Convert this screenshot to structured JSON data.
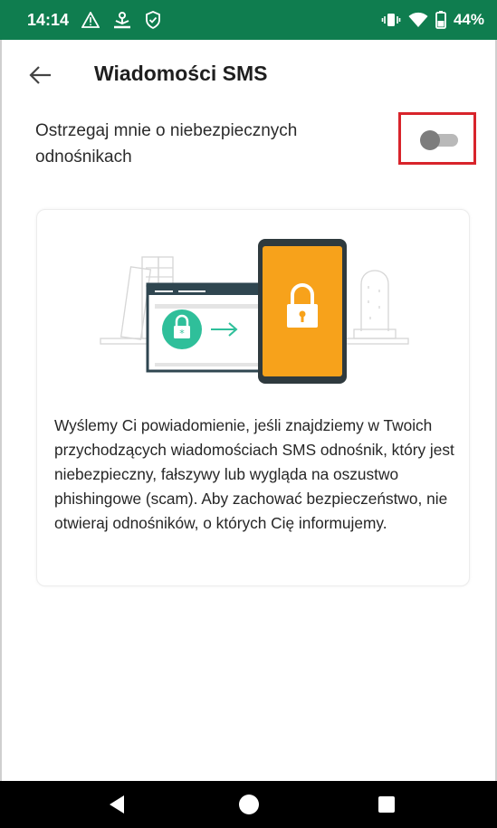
{
  "status_bar": {
    "time": "14:14",
    "battery": "44%",
    "left_icons": [
      "warning-icon",
      "usb-icon",
      "shield-icon"
    ],
    "right_icons": [
      "vibrate-icon",
      "wifi-icon",
      "battery-icon"
    ]
  },
  "app_bar": {
    "title": "Wiadomości SMS",
    "back_icon": "arrow-left-icon"
  },
  "setting": {
    "label": "Ostrzegaj mnie o niebezpiecznych odnośnikach",
    "toggle_on": false
  },
  "card": {
    "text": "Wyślemy Ci powiadomienie, jeśli znajdziemy w Twoich przychodzących wiadomościach SMS odnośnik, który jest niebezpieczny, fałszywy lub wygląda na oszustwo phishingowe (scam). Aby zachować bezpieczeństwo, nie otwieraj odnośników, o których Cię informujemy."
  },
  "nav_bar": {
    "buttons": [
      "back-triangle-icon",
      "home-circle-icon",
      "recents-square-icon"
    ]
  },
  "colors": {
    "status_bar": "#0f7d4f",
    "highlight": "#d8242b",
    "accent_teal": "#2fbf9a",
    "phone_orange": "#f7a21b"
  }
}
